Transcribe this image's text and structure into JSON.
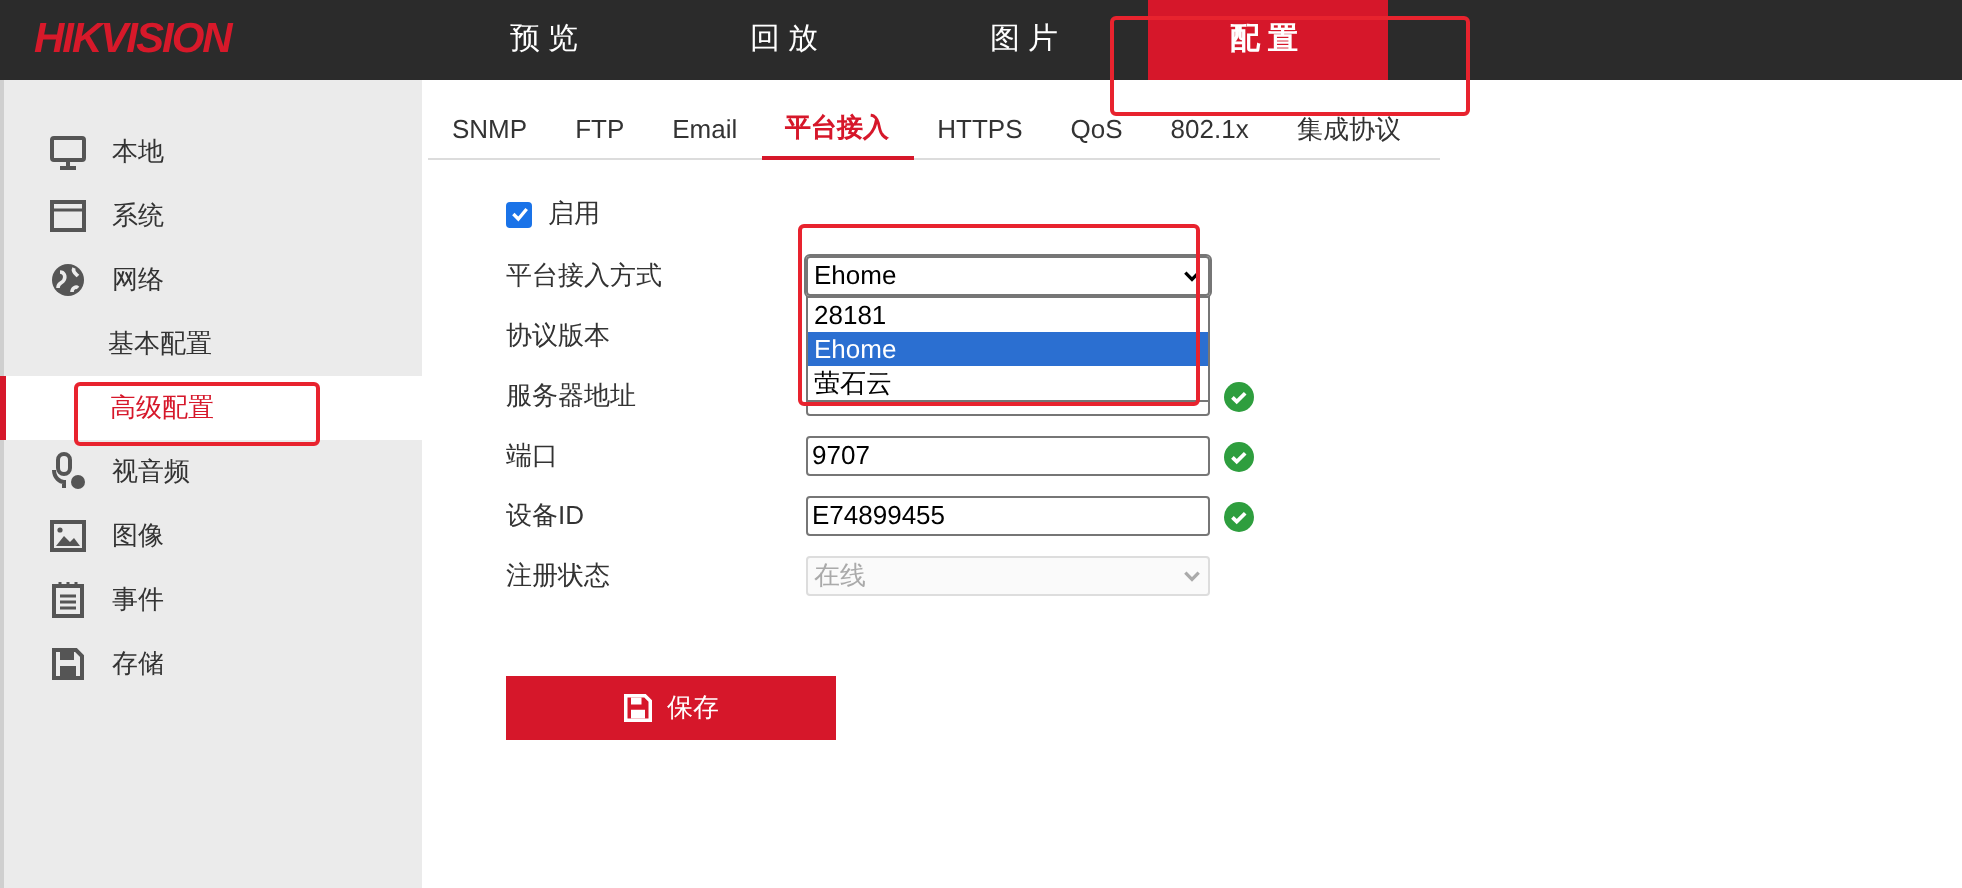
{
  "logo": "HIKVISION",
  "nav": [
    {
      "label": "预览",
      "selected": false
    },
    {
      "label": "回放",
      "selected": false
    },
    {
      "label": "图片",
      "selected": false
    },
    {
      "label": "配置",
      "selected": true
    }
  ],
  "sidebar": {
    "items": [
      {
        "label": "本地",
        "selected": false
      },
      {
        "label": "系统",
        "selected": false
      },
      {
        "label": "网络",
        "selected": false,
        "children": [
          {
            "label": "基本配置",
            "selected": false
          },
          {
            "label": "高级配置",
            "selected": true
          }
        ]
      },
      {
        "label": "视音频",
        "selected": false
      },
      {
        "label": "图像",
        "selected": false
      },
      {
        "label": "事件",
        "selected": false
      },
      {
        "label": "存储",
        "selected": false
      }
    ]
  },
  "tabs": [
    {
      "label": "SNMP",
      "selected": false
    },
    {
      "label": "FTP",
      "selected": false
    },
    {
      "label": "Email",
      "selected": false
    },
    {
      "label": "平台接入",
      "selected": true
    },
    {
      "label": "HTTPS",
      "selected": false
    },
    {
      "label": "QoS",
      "selected": false
    },
    {
      "label": "802.1x",
      "selected": false
    },
    {
      "label": "集成协议",
      "selected": false
    }
  ],
  "form": {
    "enable": {
      "label": "启用",
      "checked": true
    },
    "rows": [
      {
        "kind": "select",
        "label": "平台接入方式",
        "value": "Ehome",
        "disabled": false,
        "open": true,
        "options": [
          {
            "label": "28181",
            "selected": false
          },
          {
            "label": "Ehome",
            "selected": true
          },
          {
            "label": "萤石云",
            "selected": false
          }
        ]
      },
      {
        "kind": "hidden",
        "label": "协议版本"
      },
      {
        "kind": "covered",
        "label": "服务器地址",
        "valid": true
      },
      {
        "kind": "text",
        "label": "端口",
        "value": "9707",
        "valid": true
      },
      {
        "kind": "text",
        "label": "设备ID",
        "value": "E74899455",
        "valid": true
      },
      {
        "kind": "select",
        "label": "注册状态",
        "value": "在线",
        "disabled": true,
        "open": false
      }
    ]
  },
  "save_button": {
    "label": "保存"
  }
}
